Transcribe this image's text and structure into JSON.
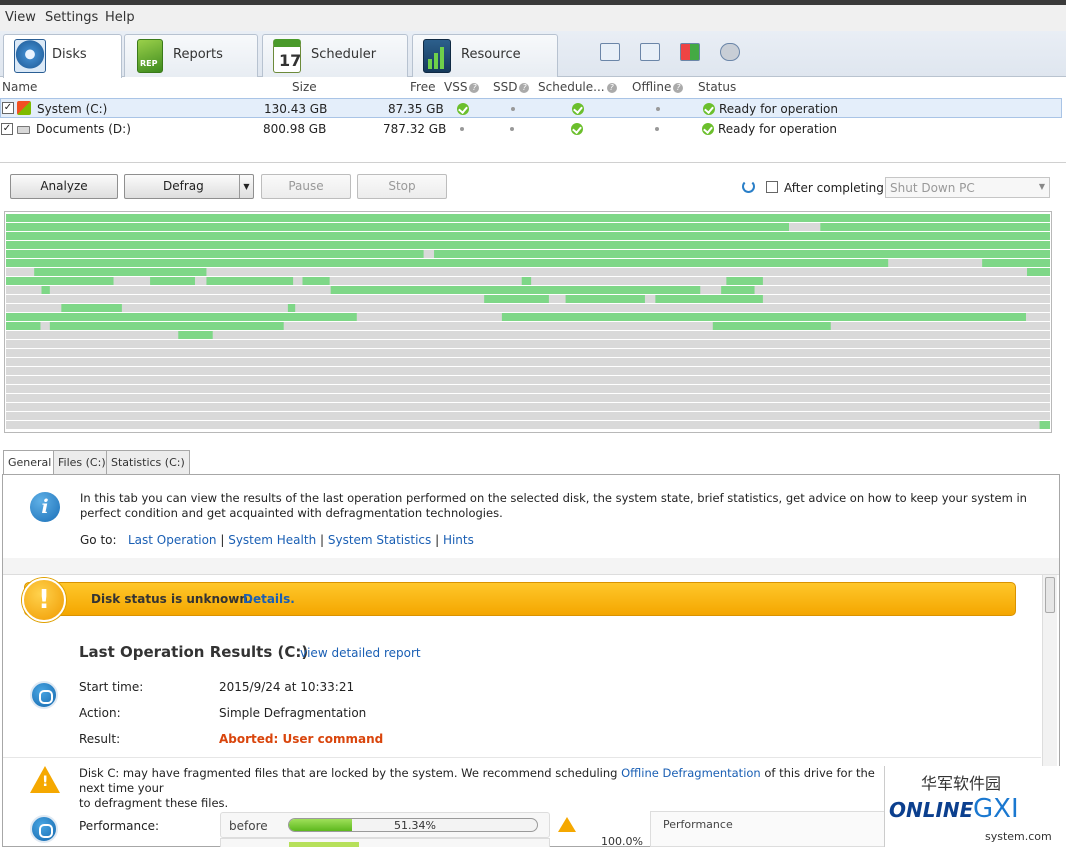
{
  "menu": {
    "items": [
      "View",
      "Settings",
      "Help"
    ]
  },
  "tabs": [
    {
      "label": "Disks"
    },
    {
      "label": "Reports"
    },
    {
      "label": "Scheduler"
    },
    {
      "label": "Resource"
    }
  ],
  "scheduler_icon_day": "17",
  "reports_icon_text": "REP",
  "table": {
    "headers": {
      "name": "Name",
      "size": "Size",
      "free": "Free",
      "vss": "VSS",
      "ssd": "SSD",
      "scheduled": "Schedule...",
      "offline": "Offline",
      "status": "Status"
    },
    "rows": [
      {
        "name": "System (C:)",
        "size": "130.43 GB",
        "free": "87.35 GB",
        "vss": true,
        "ssd": false,
        "scheduled": true,
        "offline": false,
        "status": "Ready for operation"
      },
      {
        "name": "Documents (D:)",
        "size": "800.98 GB",
        "free": "787.32 GB",
        "vss": false,
        "ssd": false,
        "scheduled": true,
        "offline": false,
        "status": "Ready for operation"
      }
    ]
  },
  "actions": {
    "analyze": "Analyze",
    "defrag": "Defrag",
    "pause": "Pause",
    "stop": "Stop",
    "after_completing": "After completing:",
    "after_option": "Shut Down PC"
  },
  "subtabs": [
    "General",
    "Files (C:)",
    "Statistics (C:)"
  ],
  "info": {
    "text": "In this tab you can view the results of the last operation performed on the selected disk, the system state, brief statistics, get advice on how to keep your system in perfect condition and get acquainted with defragmentation technologies.",
    "goto_label": "Go to:",
    "links": [
      "Last Operation",
      "System Health",
      "System Statistics",
      "Hints"
    ]
  },
  "banner": {
    "text": "Disk status is unknown.",
    "link": "Details."
  },
  "results": {
    "title": "Last Operation Results (C:)",
    "report_link": "view detailed report",
    "start_label": "Start time:",
    "start_value": "2015/9/24 at 10:33:21",
    "action_label": "Action:",
    "action_value": "Simple Defragmentation",
    "result_label": "Result:",
    "result_value": "Aborted: User command"
  },
  "advice": {
    "before": "Disk C: may have fragmented files that are locked by the system. We recommend scheduling ",
    "link": "Offline Defragmentation",
    "after": " of this drive for the next time your",
    "line2": "to defragment these files."
  },
  "performance": {
    "label": "Performance:",
    "before_label": "before",
    "before_value": "51.34%",
    "before_fraction": 0.2534,
    "pct_label": "100.0%",
    "chart_title": "Performance"
  },
  "watermark": {
    "top": "华军软件园",
    "logo": "ONLINE",
    "gxi": "GXI",
    "site": "system.com"
  },
  "colors": {
    "map_used": "#7ed787",
    "map_free": "#d9d9d9",
    "accent": "#1a5fb4",
    "banner": "#f4a600",
    "error": "#d9450c"
  }
}
